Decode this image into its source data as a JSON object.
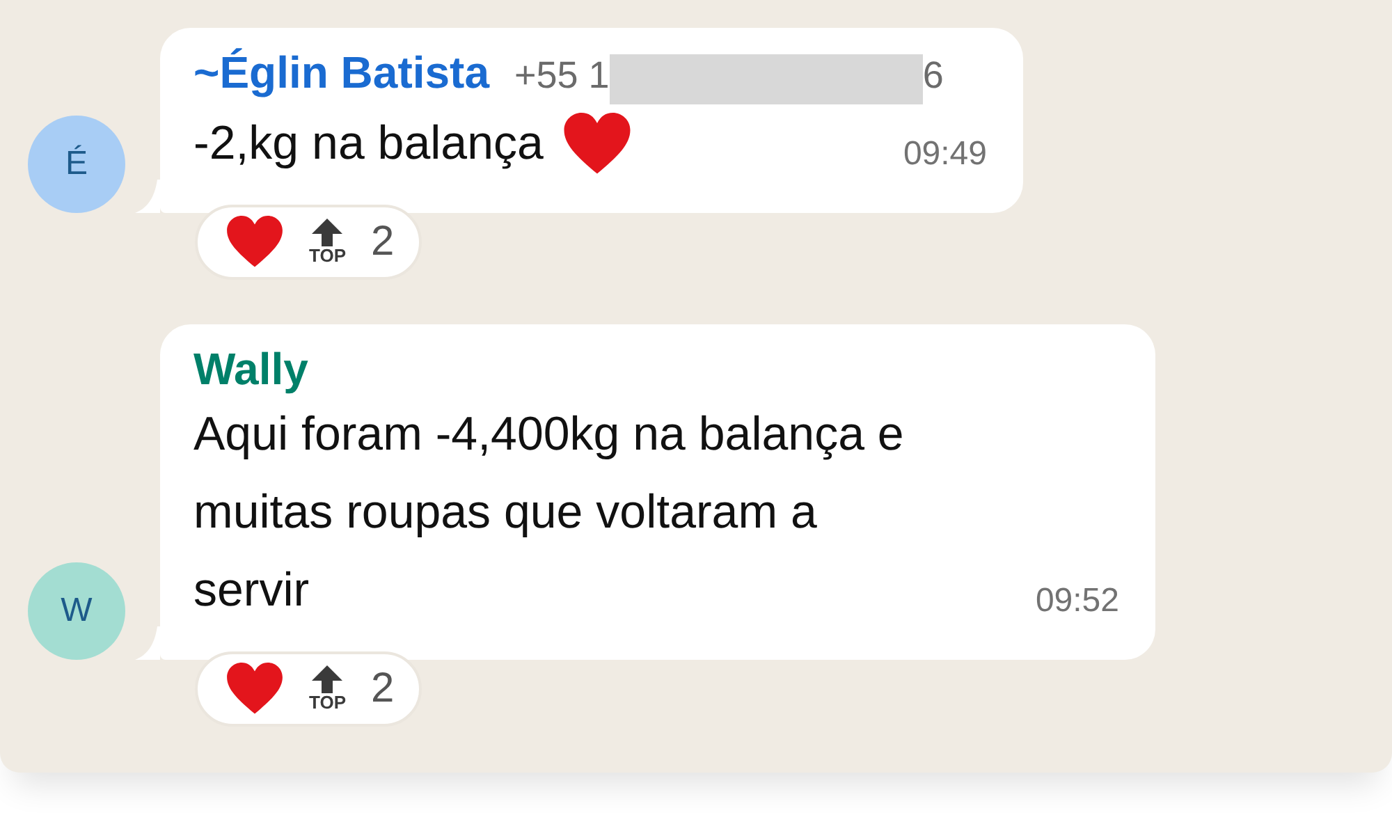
{
  "messages": [
    {
      "avatar": {
        "initial": "É",
        "color": "#a8cdf5"
      },
      "sender": {
        "name": "~Églin Batista",
        "color": "#1a6bd1"
      },
      "phone": {
        "prefix": "+55 1",
        "redacted": true,
        "suffix": "6"
      },
      "lines": [
        "-2,kg na balança"
      ],
      "emoji": {
        "kind": "heart"
      },
      "time": "09:49",
      "reactions": [
        {
          "kind": "heart"
        },
        {
          "kind": "top",
          "label": "TOP"
        }
      ],
      "reaction_count": "2"
    },
    {
      "avatar": {
        "initial": "W",
        "color": "#a3ddd2"
      },
      "sender": {
        "name": "Wally",
        "color": "#008069"
      },
      "lines": [
        "Aqui foram -4,400kg na balança e",
        "muitas roupas que voltaram a",
        "servir"
      ],
      "time": "09:52",
      "reactions": [
        {
          "kind": "heart"
        },
        {
          "kind": "top",
          "label": "TOP"
        }
      ],
      "reaction_count": "2"
    }
  ]
}
